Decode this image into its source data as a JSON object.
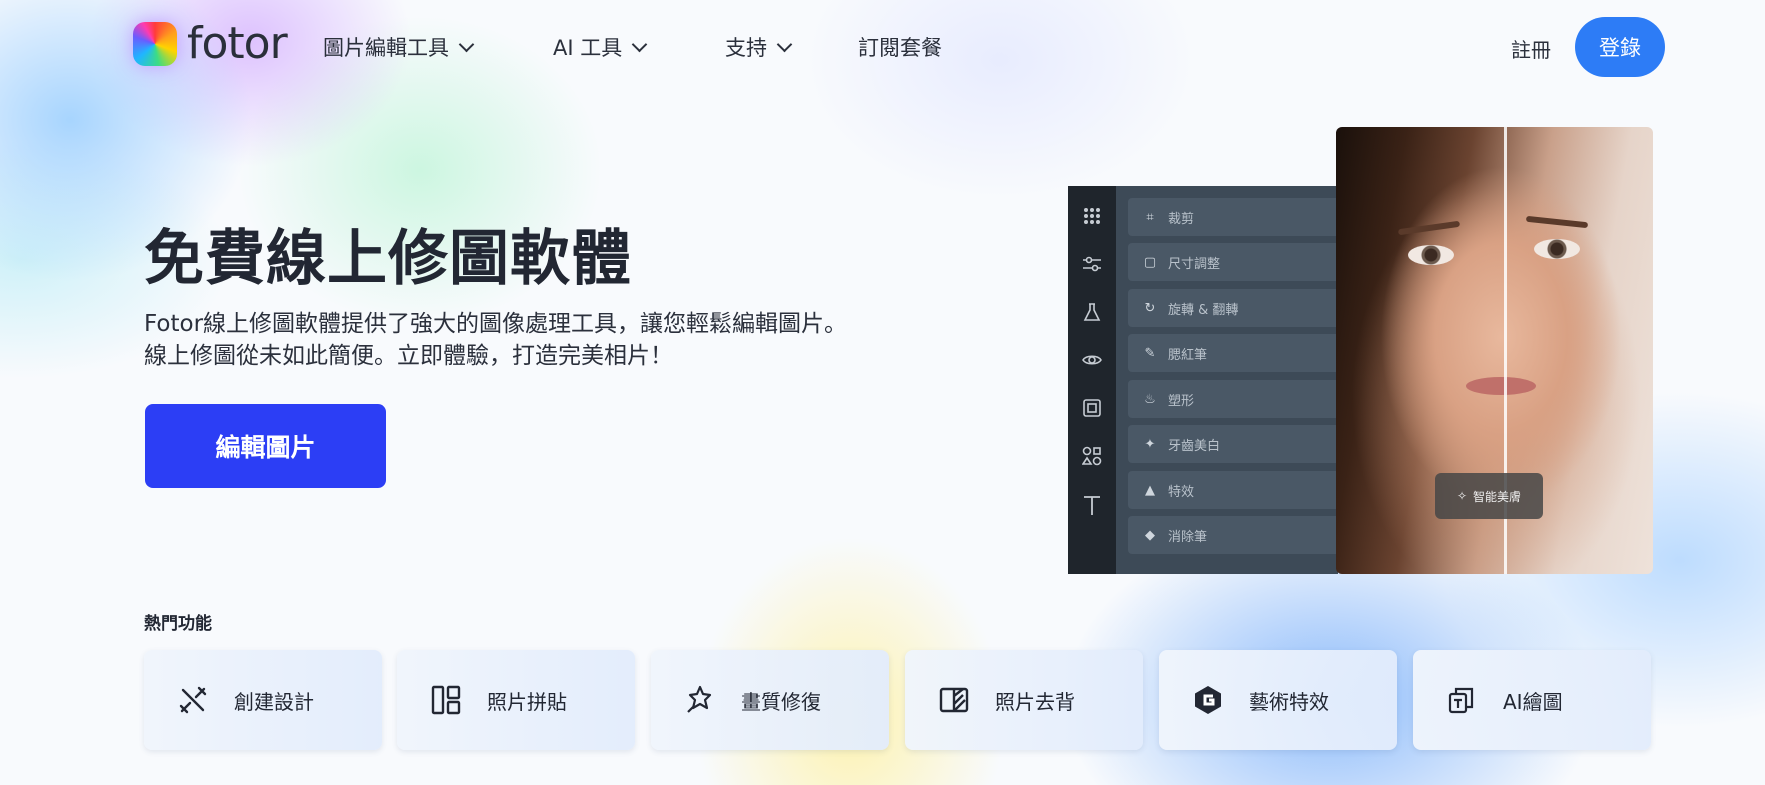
{
  "brand": {
    "name": "fotor"
  },
  "nav": {
    "items": [
      {
        "label": "圖片編輯工具",
        "has_dropdown": true
      },
      {
        "label": "AI 工具",
        "has_dropdown": true
      },
      {
        "label": "支持",
        "has_dropdown": true
      },
      {
        "label": "訂閱套餐",
        "has_dropdown": false
      }
    ],
    "signup": "註冊",
    "login": "登錄"
  },
  "hero": {
    "title": "免費線上修圖軟體",
    "desc_line1": "Fotor線上修圖軟體提供了強大的圖像處理工具，讓您輕鬆編輯圖片。",
    "desc_line2": "線上修圖從未如此簡便。立即體驗，打造完美相片！",
    "cta": "編輯圖片"
  },
  "editor": {
    "rail_icons": [
      "apps-icon",
      "sliders-icon",
      "flask-icon",
      "eye-icon",
      "frame-icon",
      "shapes-icon",
      "text-icon"
    ],
    "tools": [
      {
        "label": "裁剪",
        "icon": "crop-icon"
      },
      {
        "label": "尺寸調整",
        "icon": "resize-icon"
      },
      {
        "label": "旋轉 & 翻轉",
        "icon": "rotate-icon"
      },
      {
        "label": "腮紅筆",
        "icon": "blush-icon"
      },
      {
        "label": "塑形",
        "icon": "reshape-icon"
      },
      {
        "label": "牙齒美白",
        "icon": "teeth-icon"
      },
      {
        "label": "特效",
        "icon": "effects-icon"
      },
      {
        "label": "消除筆",
        "icon": "eraser-icon"
      }
    ]
  },
  "photo": {
    "chip_label": "智能美膚"
  },
  "features": {
    "title": "熱門功能",
    "cards": [
      {
        "label": "創建設計",
        "icon": "design-icon"
      },
      {
        "label": "照片拼貼",
        "icon": "collage-icon"
      },
      {
        "label": "畫質修復",
        "icon": "enhance-icon"
      },
      {
        "label": "照片去背",
        "icon": "remove-bg-icon"
      },
      {
        "label": "藝術特效",
        "icon": "art-effect-icon"
      },
      {
        "label": "AI繪圖",
        "icon": "ai-drawing-icon"
      }
    ]
  },
  "colors": {
    "primary_blue": "#2d7cf6",
    "cta_blue": "#2c3ef5"
  }
}
